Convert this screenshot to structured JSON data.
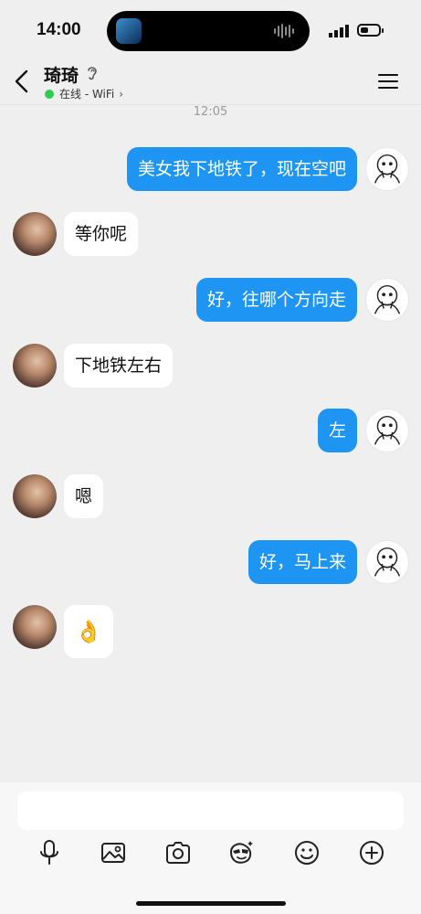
{
  "status_bar": {
    "time": "14:00"
  },
  "header": {
    "contact_name": "琦琦",
    "presence": "在线 - WiFi",
    "presence_color": "#2ecc52"
  },
  "timestamp": "12:05",
  "messages": [
    {
      "direction": "outgoing",
      "text": "美女我下地铁了，现在空吧"
    },
    {
      "direction": "incoming",
      "text": "等你呢"
    },
    {
      "direction": "outgoing",
      "text": "好，往哪个方向走"
    },
    {
      "direction": "incoming",
      "text": "下地铁左右"
    },
    {
      "direction": "outgoing",
      "text": "左"
    },
    {
      "direction": "incoming",
      "text": "嗯"
    },
    {
      "direction": "outgoing",
      "text": "好，马上来"
    },
    {
      "direction": "incoming",
      "text": "👌"
    }
  ],
  "toolbar_icons": [
    "microphone-icon",
    "image-icon",
    "camera-icon",
    "sticker-icon",
    "emoji-icon",
    "plus-icon"
  ],
  "colors": {
    "outgoing_bubble": "#1e95f2",
    "incoming_bubble": "#ffffff",
    "background": "#efefef"
  }
}
